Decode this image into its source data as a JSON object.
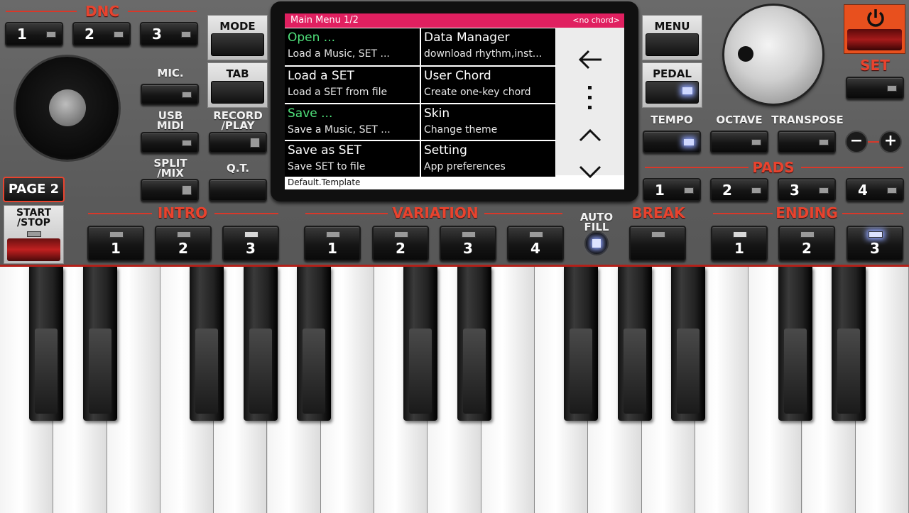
{
  "dnc": {
    "title": "DNC",
    "buttons": [
      "1",
      "2",
      "3"
    ]
  },
  "left": {
    "mode": "MODE",
    "tab": "TAB",
    "mic": "MIC.",
    "usb": "USB\nMIDI",
    "record": "RECORD\n/PLAY",
    "split": "SPLIT\n/MIX",
    "qt": "Q.T.",
    "page2": "PAGE 2",
    "start": "START\n/STOP"
  },
  "screen": {
    "header_left": "Main Menu  1/2",
    "header_right": "<no chord>",
    "items": [
      {
        "title": "Open ...",
        "sub": "Load a Music, SET ..."
      },
      {
        "title": "Data Manager",
        "sub": "download rhythm,inst..."
      },
      {
        "title": "Load a SET",
        "sub": "Load a SET from file"
      },
      {
        "title": "User Chord",
        "sub": "Create one-key chord"
      },
      {
        "title": "Save ...",
        "sub": "Save a Music, SET ..."
      },
      {
        "title": "Skin",
        "sub": "Change theme"
      },
      {
        "title": "Save as SET",
        "sub": "Save SET to file"
      },
      {
        "title": "Setting",
        "sub": "App preferences"
      }
    ],
    "footer": "Default.Template"
  },
  "right": {
    "menu": "MENU",
    "pedal": "PEDAL",
    "set": "SET",
    "tempo": "TEMPO",
    "octave": "OCTAVE",
    "transpose": "TRANSPOSE",
    "pads": "PADS",
    "pad_buttons": [
      "1",
      "2",
      "3",
      "4"
    ]
  },
  "bottom": {
    "intro": "INTRO",
    "intro_buttons": [
      "1",
      "2",
      "3"
    ],
    "variation": "VARIATION",
    "variation_buttons": [
      "1",
      "2",
      "3",
      "4"
    ],
    "autofill": "AUTO\nFILL",
    "break": "BREAK",
    "ending": "ENDING",
    "ending_buttons": [
      "1",
      "2",
      "3"
    ]
  },
  "colors": {
    "accent": "#e8432e",
    "header": "#e02060",
    "power": "#e8501e"
  },
  "icons": {
    "back": "left-arrow-icon",
    "more": "vertical-dots-icon",
    "up": "chevron-up-icon",
    "down": "chevron-down-icon",
    "power": "power-icon"
  }
}
